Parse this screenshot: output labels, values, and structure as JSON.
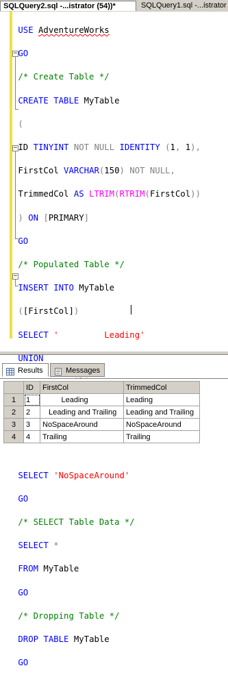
{
  "tabs": [
    {
      "label": "SQLQuery2.sql -...istrator (54))*",
      "active": true
    },
    {
      "label": "SQLQuery1.sql -...istrator",
      "active": false
    }
  ],
  "results_tabs": [
    {
      "label": "Results",
      "icon": "grid-icon",
      "active": true
    },
    {
      "label": "Messages",
      "icon": "messages-icon",
      "active": false
    }
  ],
  "grid": {
    "columns": [
      "ID",
      "FirstCol",
      "TrimmedCol"
    ],
    "rows": [
      {
        "num": "1",
        "id": "1",
        "first": "Leading",
        "trimmed": "Leading"
      },
      {
        "num": "2",
        "id": "2",
        "first": "Leading and Trailing",
        "trimmed": "Leading and Trailing"
      },
      {
        "num": "3",
        "id": "3",
        "first": "NoSpaceAround",
        "trimmed": "NoSpaceAround"
      },
      {
        "num": "4",
        "id": "4",
        "first": "Trailing",
        "trimmed": "Trailing"
      }
    ]
  },
  "colors": {
    "keyword": "#0000ff",
    "function": "#ff00ff",
    "string": "#ff0000",
    "comment": "#008000",
    "operator": "#808080",
    "changebar": "#f0e040"
  }
}
